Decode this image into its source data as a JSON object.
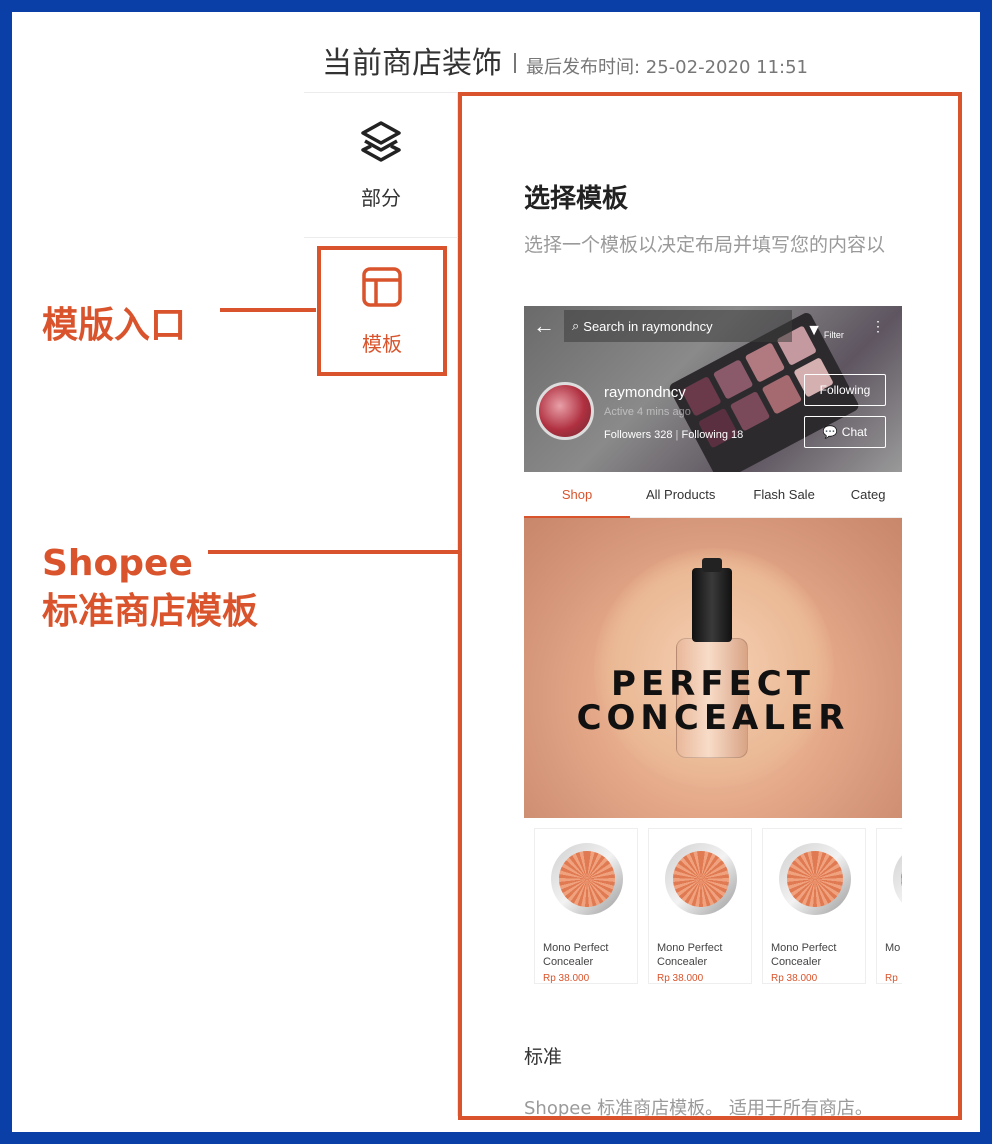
{
  "header": {
    "title": "当前商店装饰",
    "last_published": "最后发布时间: 25-02-2020 11:51"
  },
  "sidebar": {
    "items": [
      {
        "label": "部分",
        "icon": "layers-icon"
      },
      {
        "label": "模板",
        "icon": "template-icon",
        "selected": true
      }
    ]
  },
  "annotations": {
    "template_entry": "模版入口",
    "shopee_line1": "Shopee",
    "shopee_line2": "标准商店模板"
  },
  "panel": {
    "heading": "选择模板",
    "subtitle": "选择一个模板以决定布局并填写您的内容以",
    "template_name": "标准",
    "template_desc": "Shopee 标准商店模板。 适用于所有商店。"
  },
  "preview": {
    "search_placeholder": "Search in raymondncy",
    "filter_label": "Filter",
    "shop_name": "raymondncy",
    "active_status": "Active 4 mins ago",
    "followers": "Followers 328",
    "following_count": "Following 18",
    "follow_button": "Following",
    "chat_button": "Chat",
    "tabs": [
      "Shop",
      "All Products",
      "Flash Sale",
      "Categ"
    ],
    "banner_line1": "PERFECT",
    "banner_line2": "CONCEALER",
    "products": [
      {
        "name": "Mono Perfect Concealer",
        "price": "Rp 38.000"
      },
      {
        "name": "Mono Perfect Concealer",
        "price": "Rp 38.000"
      },
      {
        "name": "Mono Perfect Concealer",
        "price": "Rp 38.000"
      },
      {
        "name": "Mo Ba",
        "price": "Rp"
      }
    ]
  },
  "colors": {
    "accent": "#d9542c",
    "frame_border": "#0a3fa8"
  }
}
